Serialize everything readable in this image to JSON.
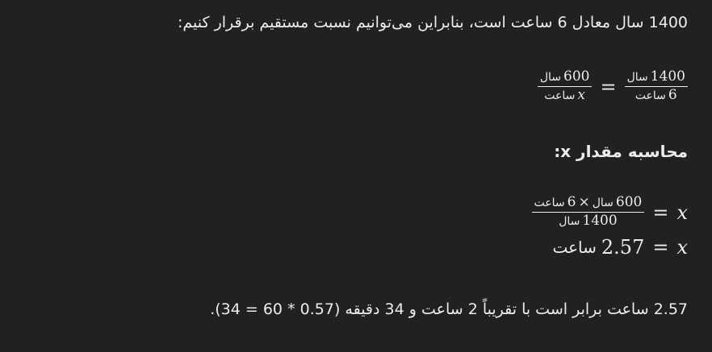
{
  "intro_line": "1400 سال معادل 6 ساعت است، بنابراین می‌توانیم نسبت مستقیم برقرار کنیم:",
  "eq1": {
    "left": {
      "num_value": "600",
      "num_unit": "سال",
      "den_value": "x",
      "den_unit": "ساعت"
    },
    "equals": "=",
    "right": {
      "num_value": "1400",
      "num_unit": "سال",
      "den_value": "6",
      "den_unit": "ساعت"
    }
  },
  "heading": "محاسبه مقدار x:",
  "eq2": {
    "var": "x",
    "equals": "=",
    "num_a_value": "600",
    "num_a_unit": "سال",
    "times": "×",
    "num_b_value": "6",
    "num_b_unit": "ساعت",
    "den_value": "1400",
    "den_unit": "سال"
  },
  "eq3": {
    "var": "x",
    "equals": "=",
    "value": "2.57",
    "unit": "ساعت"
  },
  "conclusion_line": "2.57 ساعت برابر است با تقریباً 2 ساعت و 34 دقیقه (0.57 * 60 = 34)."
}
